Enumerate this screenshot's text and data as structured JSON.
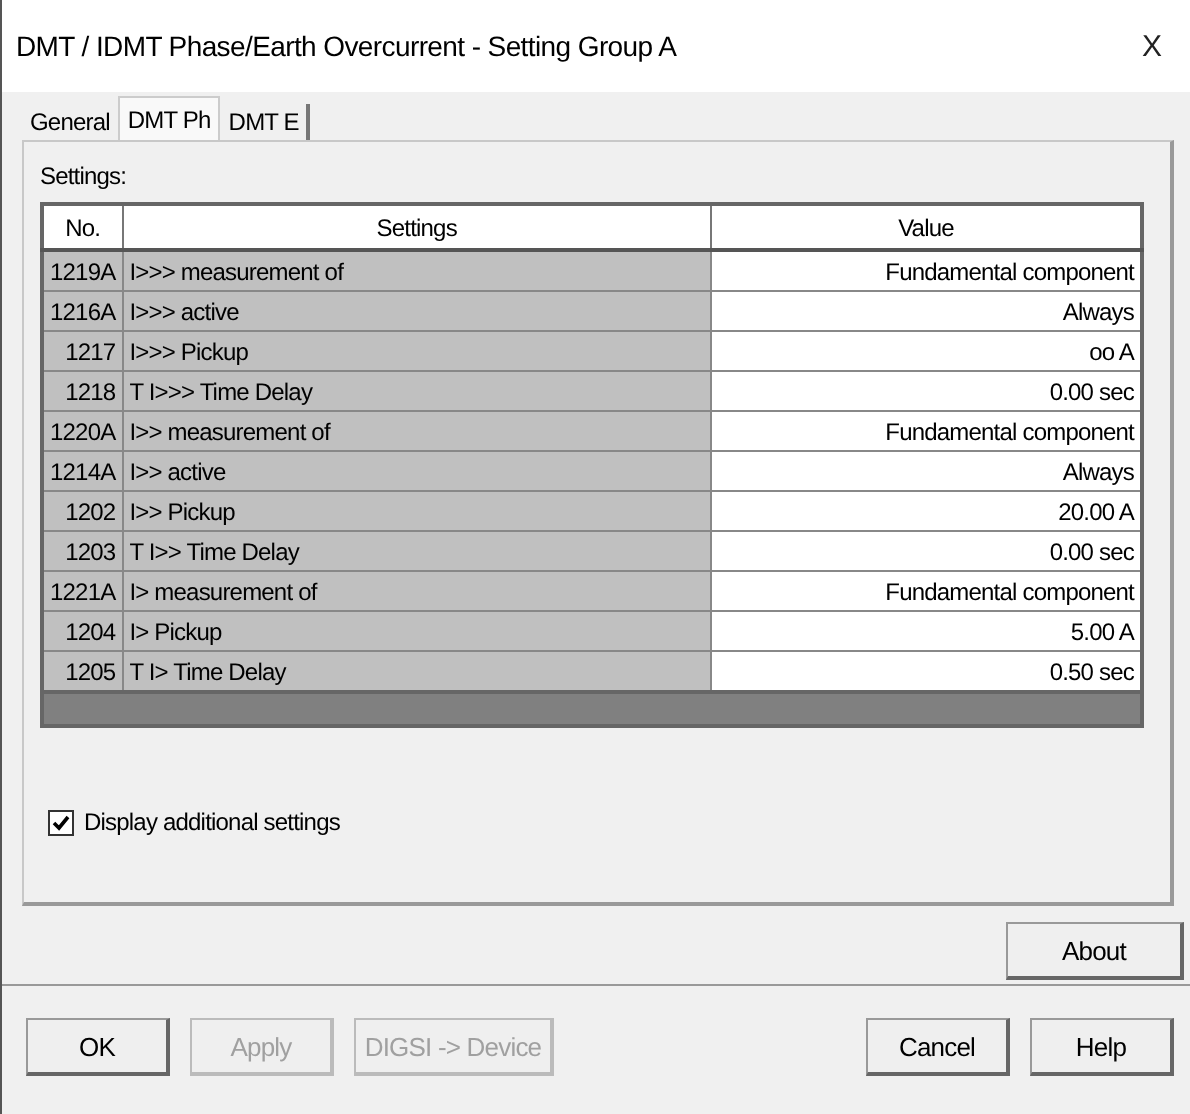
{
  "window": {
    "title": "DMT / IDMT Phase/Earth Overcurrent - Setting Group A",
    "close": "X"
  },
  "tabs": [
    {
      "label": "General",
      "selected": false
    },
    {
      "label": "DMT Ph",
      "selected": true
    },
    {
      "label": "DMT E",
      "selected": false
    }
  ],
  "settings_label": "Settings:",
  "table": {
    "columns": [
      "No.",
      "Settings",
      "Value"
    ],
    "rows": [
      {
        "no": "1219A",
        "setting": "I>>> measurement of",
        "value": "Fundamental component"
      },
      {
        "no": "1216A",
        "setting": "I>>> active",
        "value": "Always"
      },
      {
        "no": "1217",
        "setting": "I>>> Pickup",
        "value": "oo A"
      },
      {
        "no": "1218",
        "setting": "T I>>> Time Delay",
        "value": "0.00 sec"
      },
      {
        "no": "1220A",
        "setting": "I>> measurement of",
        "value": "Fundamental component"
      },
      {
        "no": "1214A",
        "setting": "I>> active",
        "value": "Always"
      },
      {
        "no": "1202",
        "setting": "I>> Pickup",
        "value": "20.00 A"
      },
      {
        "no": "1203",
        "setting": "T I>> Time Delay",
        "value": "0.00 sec"
      },
      {
        "no": "1221A",
        "setting": "I> measurement of",
        "value": "Fundamental component"
      },
      {
        "no": "1204",
        "setting": "I> Pickup",
        "value": "5.00 A"
      },
      {
        "no": "1205",
        "setting": "T I> Time Delay",
        "value": "0.50 sec"
      }
    ]
  },
  "display_additional": {
    "label": "Display additional settings",
    "checked": true
  },
  "about_button": "About",
  "buttons": [
    {
      "label": "OK",
      "disabled": false
    },
    {
      "label": "Apply",
      "disabled": true
    },
    {
      "label": "DIGSI -> Device",
      "disabled": true
    },
    {
      "label": "Cancel",
      "disabled": false
    },
    {
      "label": "Help",
      "disabled": false
    }
  ]
}
